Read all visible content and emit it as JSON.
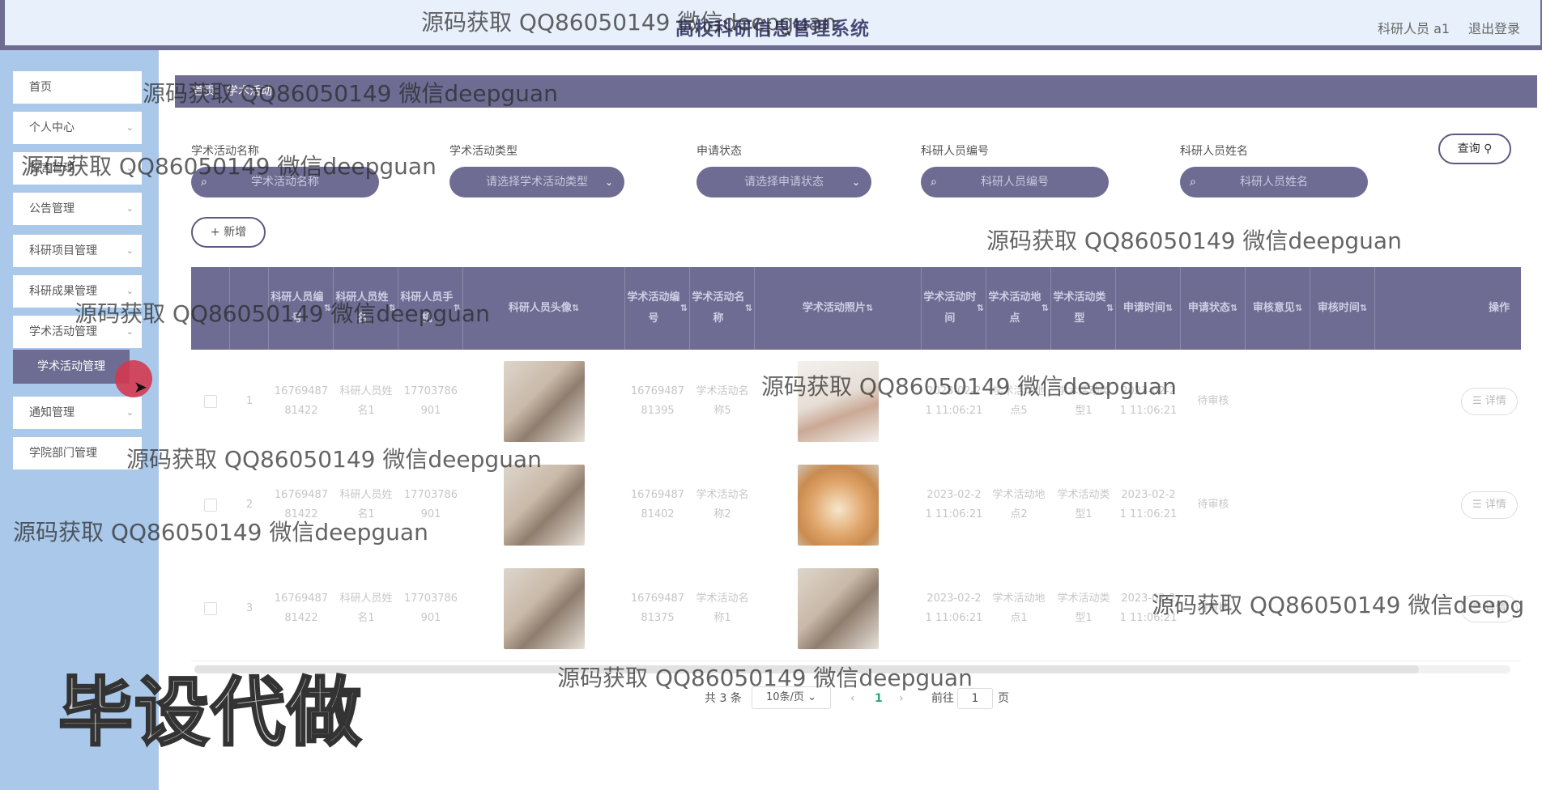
{
  "header": {
    "title": "高校科研信息管理系统",
    "user": "科研人员 a1",
    "logout": "退出登录"
  },
  "sidebar": {
    "items": [
      {
        "label": "首页",
        "has_children": false
      },
      {
        "label": "个人中心",
        "has_children": true
      },
      {
        "label": "留言管理",
        "has_children": true
      },
      {
        "label": "公告管理",
        "has_children": true
      },
      {
        "label": "科研项目管理",
        "has_children": true
      },
      {
        "label": "科研成果管理",
        "has_children": true
      },
      {
        "label": "学术活动管理",
        "has_children": true
      },
      {
        "label": "通知管理",
        "has_children": true
      },
      {
        "label": "学院部门管理",
        "has_children": true
      }
    ],
    "active_sub": "学术活动管理",
    "chevron_icon": "chevron-down-icon"
  },
  "breadcrumb": {
    "home": "首页",
    "current": "学术活动"
  },
  "filters": [
    {
      "label": "学术活动名称",
      "placeholder": "学术活动名称",
      "type": "search"
    },
    {
      "label": "学术活动类型",
      "placeholder": "请选择学术活动类型",
      "type": "select"
    },
    {
      "label": "申请状态",
      "placeholder": "请选择申请状态",
      "type": "select"
    },
    {
      "label": "科研人员编号",
      "placeholder": "科研人员编号",
      "type": "search"
    },
    {
      "label": "科研人员姓名",
      "placeholder": "科研人员姓名",
      "type": "search"
    }
  ],
  "buttons": {
    "query": "查询",
    "add": "+ 新增",
    "detail": "详情"
  },
  "table": {
    "headers": [
      "",
      "",
      "科研人员编号",
      "科研人员姓名",
      "科研人员手机",
      "科研人员头像",
      "学术活动编号",
      "学术活动名称",
      "学术活动照片",
      "学术活动时间",
      "学术活动地点",
      "学术活动类型",
      "申请时间",
      "申请状态",
      "审核意见",
      "审核时间",
      "操作"
    ],
    "rows": [
      {
        "index": "1",
        "staff_no": "1676948781422",
        "staff_name": "科研人员姓名1",
        "phone": "17703786901",
        "activity_no": "1676948781395",
        "activity_name": "学术活动名称5",
        "activity_time": "2023-02-21 11:06:21",
        "location": "学术活动地点5",
        "type": "学术活动类型1",
        "apply_time": "2023-02-21 11:06:21",
        "status": "待审核",
        "review_opinion": "",
        "review_time": "",
        "activity_photo": "woman"
      },
      {
        "index": "2",
        "staff_no": "1676948781422",
        "staff_name": "科研人员姓名1",
        "phone": "17703786901",
        "activity_no": "1676948781402",
        "activity_name": "学术活动名称2",
        "activity_time": "2023-02-21 11:06:21",
        "location": "学术活动地点2",
        "type": "学术活动类型1",
        "apply_time": "2023-02-21 11:06:21",
        "status": "待审核",
        "review_opinion": "",
        "review_time": "",
        "activity_photo": "dog"
      },
      {
        "index": "3",
        "staff_no": "1676948781422",
        "staff_name": "科研人员姓名1",
        "phone": "17703786901",
        "activity_no": "1676948781375",
        "activity_name": "学术活动名称1",
        "activity_time": "2023-02-21 11:06:21",
        "location": "学术活动地点1",
        "type": "学术活动类型1",
        "apply_time": "2023-02-21 11:06:21",
        "status": "待审核",
        "review_opinion": "",
        "review_time": "",
        "activity_photo": "man"
      }
    ]
  },
  "pagination": {
    "total": "共 3 条",
    "page_size": "10条/页",
    "current": "1",
    "goto_prefix": "前往",
    "goto_value": "1",
    "goto_suffix": "页"
  },
  "watermarks": {
    "text": "源码获取 QQ86050149 微信deepguan",
    "text_cut": "源码获取 QQ86050149 微信deepg",
    "big": "毕设代做"
  }
}
